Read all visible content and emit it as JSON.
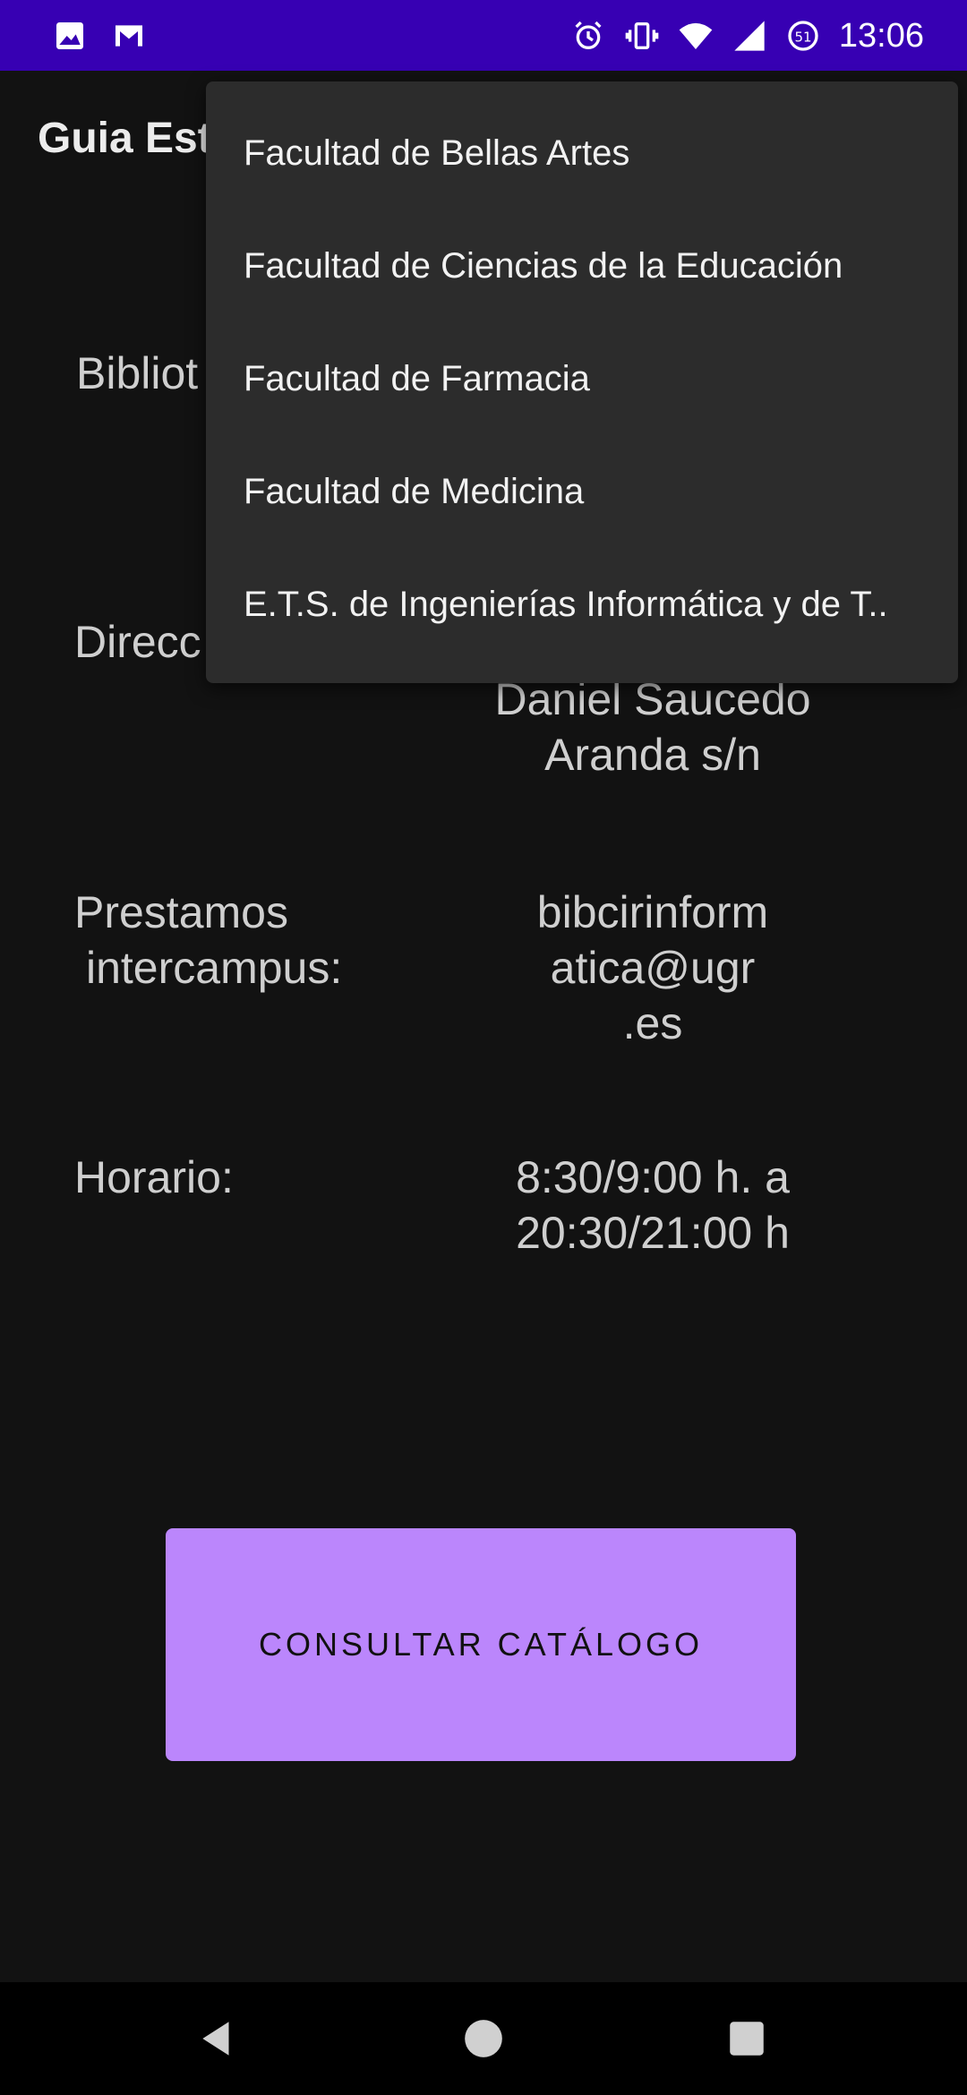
{
  "status_bar": {
    "time": "13:06",
    "icons_left": [
      "image-icon",
      "gmail-icon"
    ],
    "icons_right": [
      "alarm-icon",
      "vibrate-icon",
      "wifi-icon",
      "signal-icon",
      "data-saver-icon"
    ]
  },
  "app_bar": {
    "title": "Guia Est"
  },
  "library": {
    "label_partial": "Bibliot",
    "address_label_partial": "Direcc",
    "address_value_line1": "Daniel Saucedo",
    "address_value_line2": "Aranda s/n",
    "loans_label_line1": "Prestamos",
    "loans_label_line2": "intercampus:",
    "loans_value_line1": "bibcirinform",
    "loans_value_line2": "atica@ugr",
    "loans_value_line3": ".es",
    "schedule_label": "Horario:",
    "schedule_value_line1": "8:30/9:00 h. a",
    "schedule_value_line2": "20:30/21:00 h"
  },
  "button": {
    "label": "CONSULTAR CATÁLOGO"
  },
  "dropdown": {
    "items": [
      "Facultad de Bellas Artes",
      "Facultad de Ciencias de la Educación",
      "Facultad de Farmacia",
      "Facultad de Medicina",
      "E.T.S. de Ingenierías Informática y de T.."
    ]
  },
  "nav_bar": {
    "buttons": [
      "back-icon",
      "home-icon",
      "recents-icon"
    ]
  },
  "colors": {
    "status_bar": "#3700b3",
    "background": "#121212",
    "button": "#bb86fc",
    "menu": "#2c2c2c"
  }
}
